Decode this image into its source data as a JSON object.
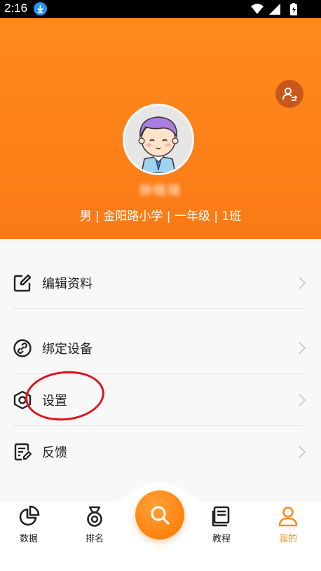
{
  "status_bar": {
    "time": "2:16"
  },
  "profile": {
    "name": "钟晓琦",
    "info": "男 | 金阳路小学 | 一年级 | 1班"
  },
  "menu": {
    "items": [
      {
        "label": "编辑资料",
        "icon": "edit-icon"
      },
      {
        "label": "绑定设备",
        "icon": "link-icon"
      },
      {
        "label": "设置",
        "icon": "settings-icon"
      },
      {
        "label": "反馈",
        "icon": "feedback-icon"
      }
    ]
  },
  "nav": {
    "items": [
      {
        "label": "数据",
        "icon": "pie-chart-icon"
      },
      {
        "label": "排名",
        "icon": "medal-icon"
      },
      {
        "label": "教程",
        "icon": "book-icon"
      },
      {
        "label": "我的",
        "icon": "user-icon",
        "active": true
      }
    ],
    "center_icon": "search-icon"
  },
  "colors": {
    "accent": "#ff8a1c",
    "annotation": "#e0131b"
  }
}
